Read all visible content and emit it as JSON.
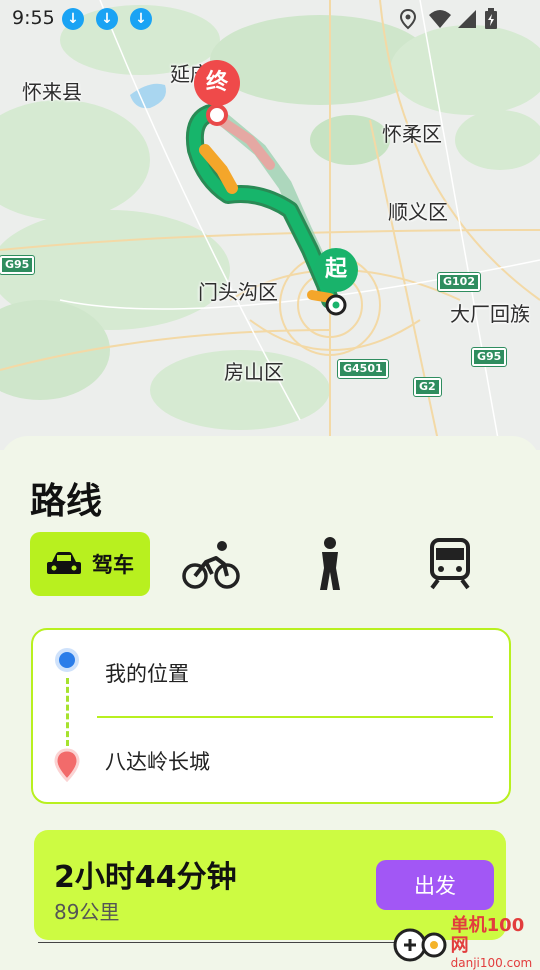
{
  "status": {
    "time": "9:55"
  },
  "map": {
    "labels": {
      "huailai": "怀来县",
      "yan": "延庆",
      "huairou": "怀柔区",
      "shunyi": "顺义区",
      "mentougou": "门头沟区",
      "dachang": "大厂回族",
      "fangshan": "房山区"
    },
    "shields": {
      "g95_left": "G95",
      "g102": "G102",
      "g95_right": "G95",
      "g4501": "G4501",
      "g2": "G2"
    },
    "pins": {
      "end": "终",
      "start": "起"
    }
  },
  "panel": {
    "title": "路线",
    "modes": [
      {
        "label": "驾车",
        "icon": "car-icon",
        "active": true
      },
      {
        "icon": "bicycle-icon"
      },
      {
        "icon": "walking-icon"
      },
      {
        "icon": "train-icon"
      }
    ],
    "origin": "我的位置",
    "destination": "八达岭长城",
    "result": {
      "duration": "2小时44分钟",
      "distance": "89公里",
      "go_label": "出发"
    }
  },
  "watermark": {
    "brand": "单机100网",
    "url": "danji100.com"
  },
  "colors": {
    "accent": "#b8f01f",
    "button": "#a257f5",
    "result_bg": "#cdfb42"
  }
}
